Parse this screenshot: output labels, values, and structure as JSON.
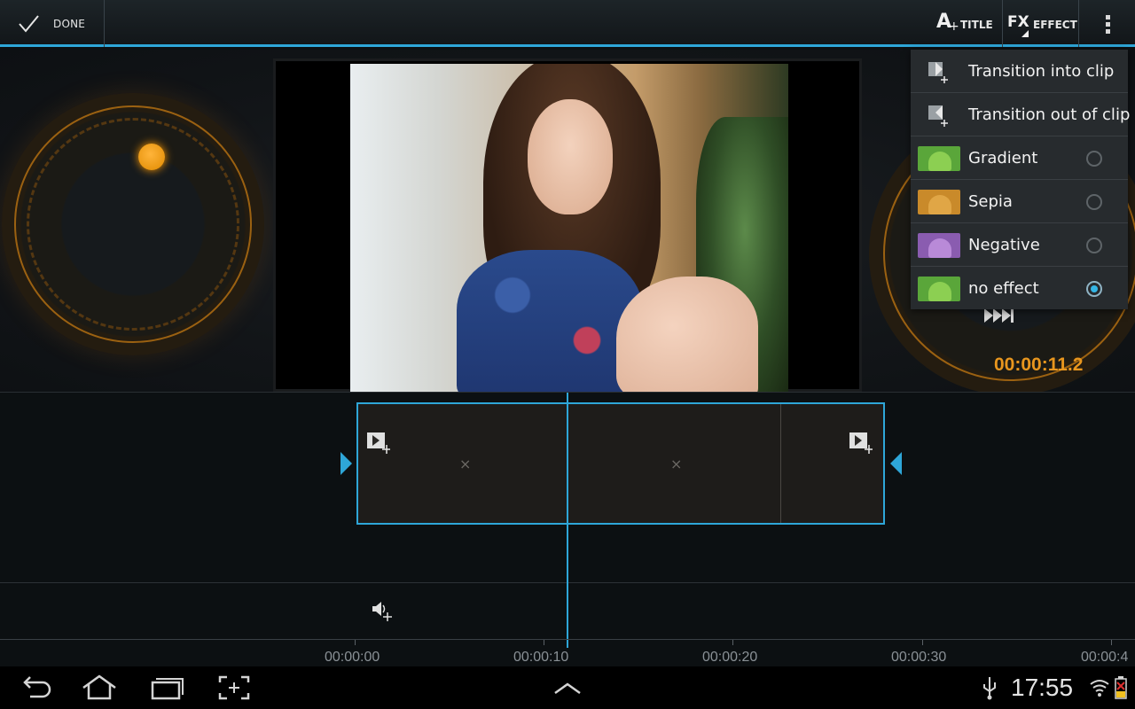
{
  "actionbar": {
    "done_label": "DONE",
    "title_label": "TITLE",
    "effect_label": "EFFECT",
    "title_icon": "text-add-icon",
    "effect_icon": "fx-icon",
    "overflow_icon": "overflow-menu-icon"
  },
  "preview": {
    "timecode": "00:00:11.2"
  },
  "menu": {
    "items": [
      {
        "label": "Transition into clip",
        "icon": "transition-in-icon"
      },
      {
        "label": "Transition out of clip",
        "icon": "transition-out-icon"
      },
      {
        "label": "Gradient",
        "thumb_color": "#5aa63a",
        "droid_color": "#8ccf52",
        "selected": false
      },
      {
        "label": "Sepia",
        "thumb_color": "#c98a2a",
        "droid_color": "#e0a646",
        "selected": false
      },
      {
        "label": "Negative",
        "thumb_color": "#8a5cb0",
        "droid_color": "#b98ad8",
        "selected": false
      },
      {
        "label": "no effect",
        "thumb_color": "#5aa63a",
        "droid_color": "#8ccf52",
        "selected": true
      }
    ]
  },
  "timeline": {
    "ticks": [
      "00:00:00",
      "00:00:10",
      "00:00:20",
      "00:00:30",
      "00:00:4"
    ]
  },
  "statusbar": {
    "time": "17:55"
  },
  "colors": {
    "accent": "#2ea6d8",
    "dial": "#e8961e",
    "timecode": "#e8961e"
  }
}
